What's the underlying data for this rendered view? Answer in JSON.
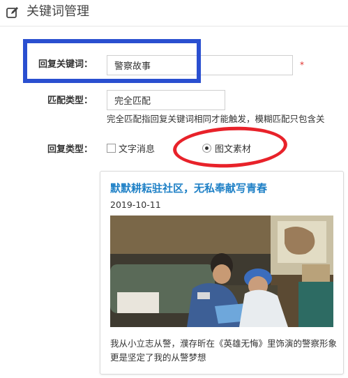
{
  "header": {
    "title": "关键词管理",
    "icon": "edit-icon"
  },
  "form": {
    "keyword": {
      "label": "回复关键词：",
      "value": "警察故事",
      "required_mark": "*"
    },
    "match_type": {
      "label": "匹配类型：",
      "value": "完全匹配",
      "help": "完全匹配指回复关键词相同才能触发，模糊匹配只包含关"
    },
    "reply_type": {
      "label": "回复类型：",
      "options": [
        {
          "label": "文字消息",
          "selected": false
        },
        {
          "label": "图文素材",
          "selected": true
        }
      ]
    }
  },
  "card": {
    "title": "默默耕耘驻社区，无私奉献写青春",
    "date": "2019-10-11",
    "description": "我从小立志从警，濮存昕在《英雄无悔》里饰演的警察形象更是坚定了我的从警梦想"
  },
  "annotations": {
    "highlight_box_color": "#2a4fd0",
    "highlight_ellipse_color": "#e8222a"
  }
}
